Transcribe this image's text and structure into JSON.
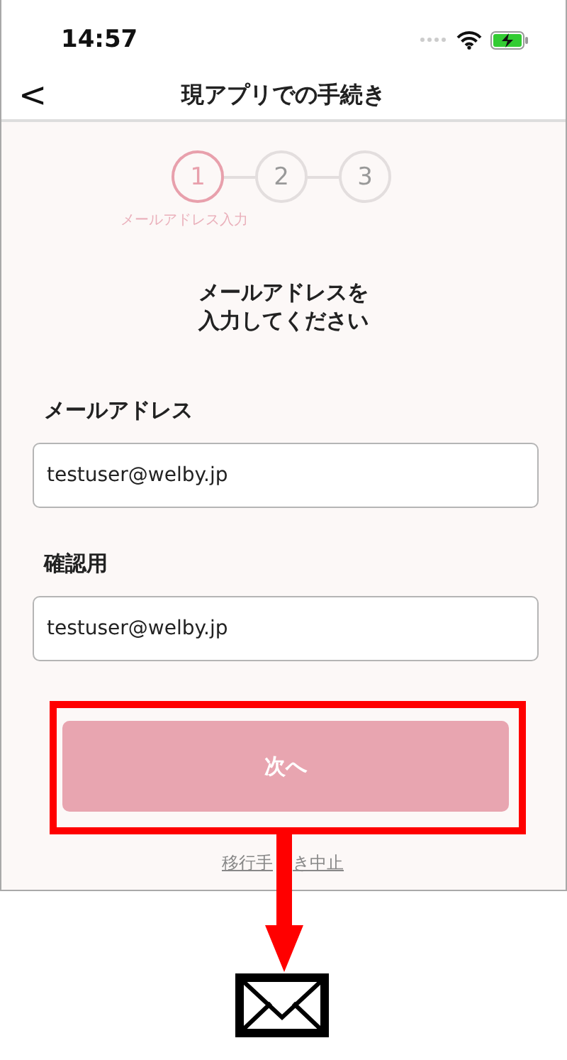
{
  "status_bar": {
    "time": "14:57"
  },
  "nav": {
    "back": "<",
    "title": "現アプリでの手続き"
  },
  "stepper": {
    "steps": [
      {
        "number": "1",
        "label": "メールアドレス入力",
        "selected": true
      },
      {
        "number": "2",
        "selected": false
      },
      {
        "number": "3",
        "selected": false
      }
    ]
  },
  "heading": [
    "メールアドレスを",
    "入力してください"
  ],
  "fields": [
    {
      "label": "メールアドレス",
      "value": "testuser@welby.jp"
    },
    {
      "label": "確認用",
      "value": "testuser@welby.jp"
    }
  ],
  "next_button": {
    "label": "次へ",
    "disabled": true
  },
  "cancel_link": [
    "移行手",
    "き中止"
  ]
}
